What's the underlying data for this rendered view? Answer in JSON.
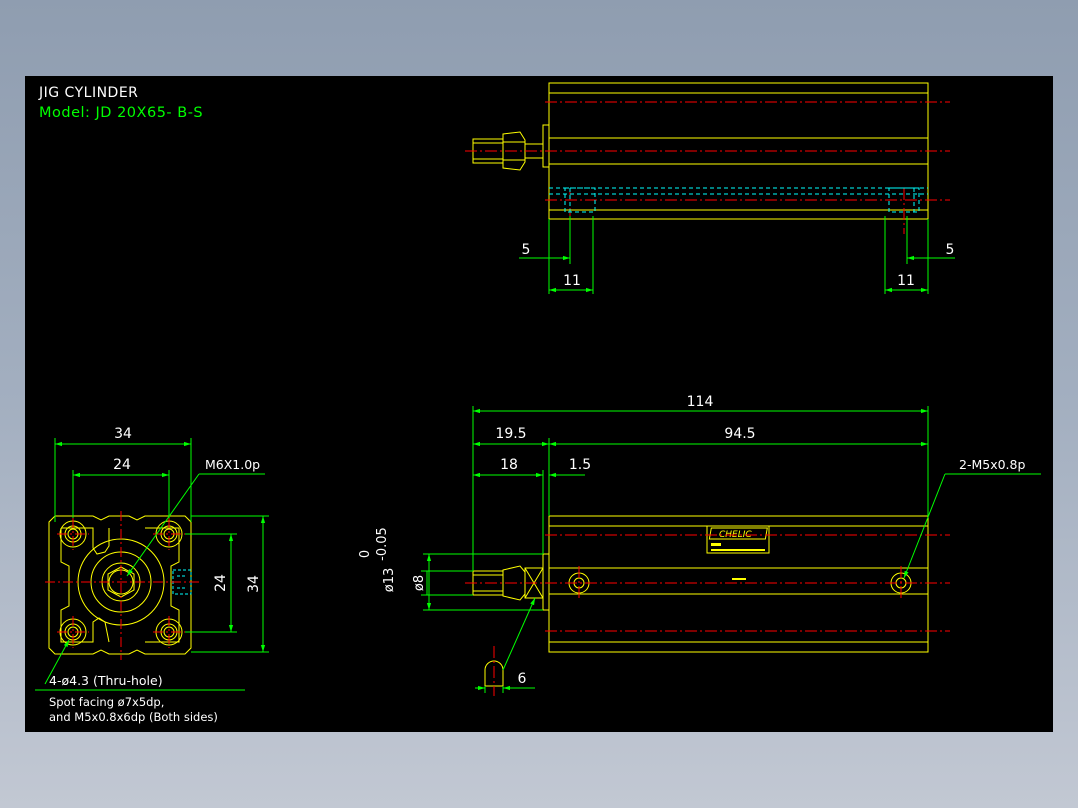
{
  "title": "JIG CYLINDER",
  "model": "Model: JD 20X65- B-S",
  "colors": {
    "background": "#000000",
    "outline": "#ffff00",
    "dimension": "#00ff00",
    "centerline": "#ff0000",
    "hidden": "#00ffff",
    "text_white": "#ffffff"
  },
  "top_view": {
    "dim_left_offset": "5",
    "dim_left_pitch": "11",
    "dim_right_pitch": "11",
    "dim_right_offset": "5"
  },
  "end_view": {
    "dim_width_outer": "34",
    "dim_width_inner": "24",
    "dim_height_inner": "24",
    "dim_height_outer": "34",
    "rod_thread": "M6X1.0p",
    "hole_note": "4-ø4.3 (Thru-hole)",
    "spot_note_1": "Spot facing ø7x5dp,",
    "spot_note_2": "and M5x0.8x6dp (Both sides)"
  },
  "side_view": {
    "dim_overall": "114",
    "dim_rod_extension": "19.5",
    "dim_body": "94.5",
    "dim_rod_thread_len": "18",
    "dim_flange": "1.5",
    "dim_rod_dia": "ø13",
    "dim_rod_tol_upper": "0",
    "dim_rod_tol_lower": "-0.05",
    "dim_pin_dia": "ø8",
    "dim_wrench": "6",
    "port_note": "2-M5x0.8p",
    "brand": "CHELIC"
  }
}
